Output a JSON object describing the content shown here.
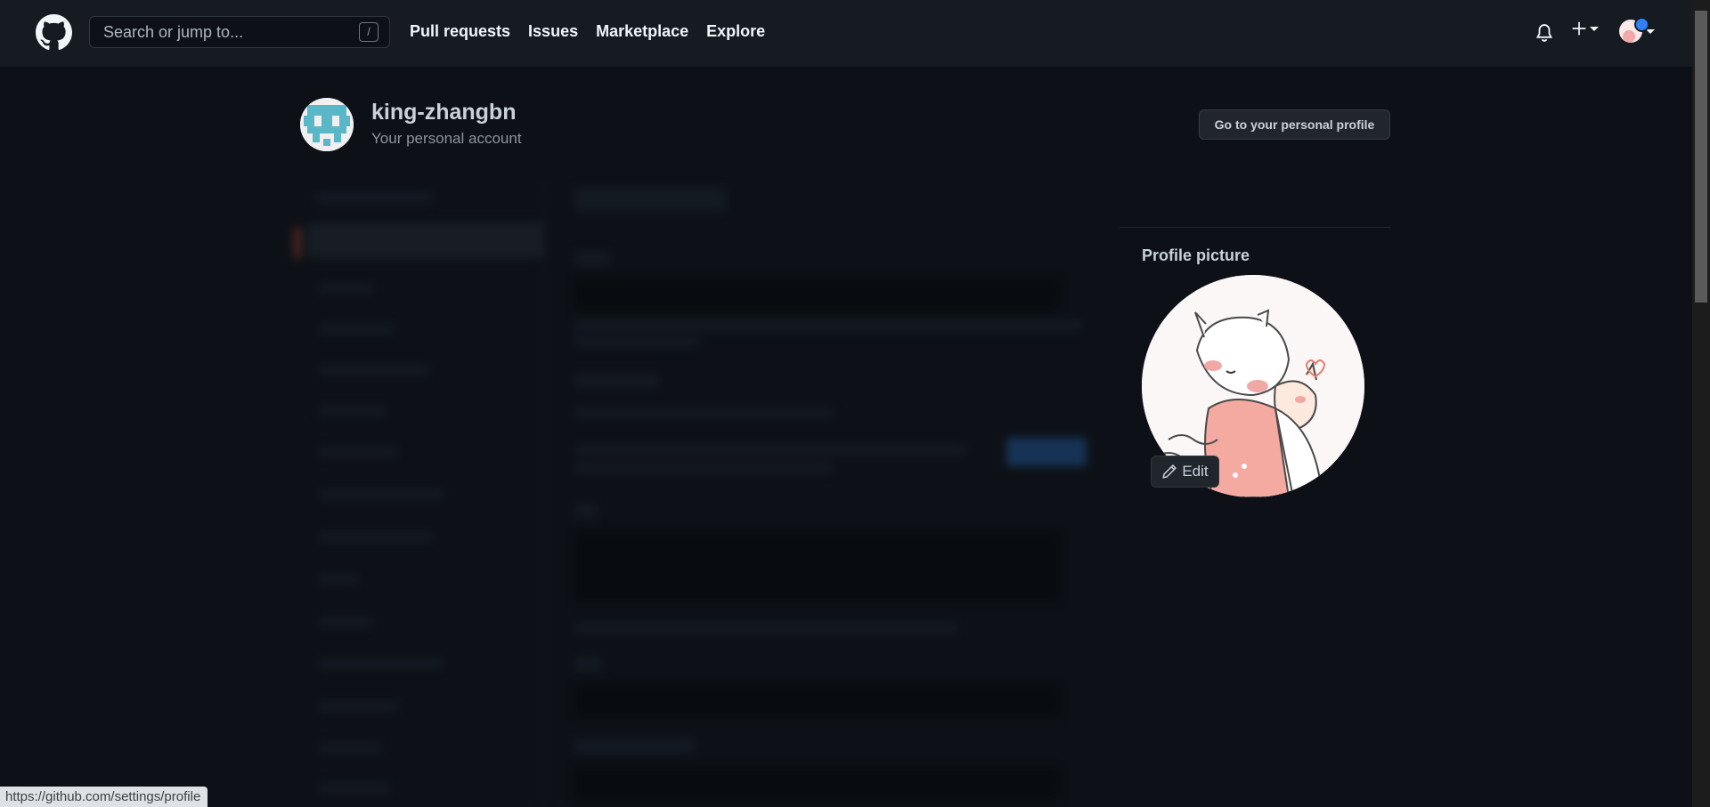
{
  "header": {
    "search_placeholder": "Search or jump to...",
    "search_shortcut": "/",
    "nav": [
      "Pull requests",
      "Issues",
      "Marketplace",
      "Explore"
    ],
    "icons": [
      "github-logo-icon",
      "bell-icon",
      "plus-icon",
      "avatar"
    ]
  },
  "account": {
    "username": "king-zhangbn",
    "subtitle": "Your personal account",
    "profile_button": "Go to your personal profile"
  },
  "profile_picture": {
    "title": "Profile picture",
    "edit_label": "Edit"
  },
  "status_bar": {
    "url": "https://github.com/settings/profile"
  },
  "colors": {
    "background": "#0d1117",
    "header": "#161b22",
    "button": "#21262d",
    "accent_blue": "#2f81f7"
  }
}
